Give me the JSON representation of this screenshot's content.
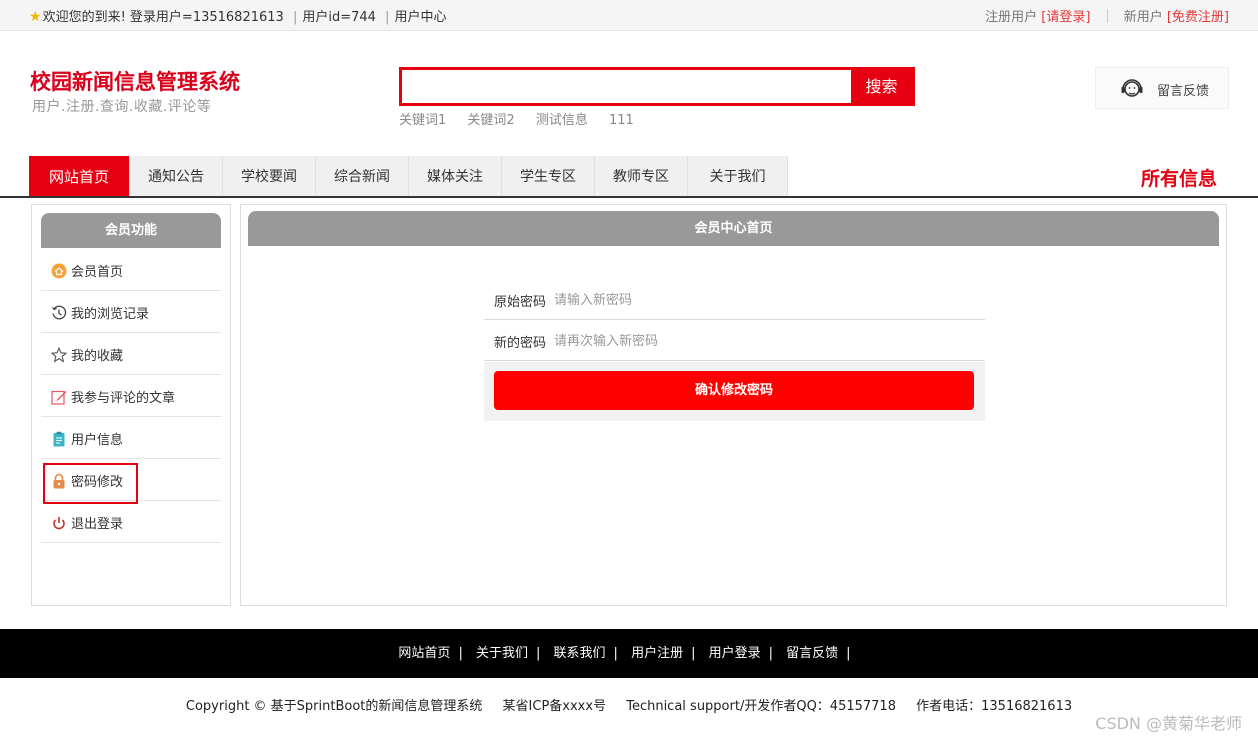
{
  "topbar": {
    "welcome": "欢迎您的到来!",
    "login_user": "登录用户=13516821613",
    "user_id": "用户id=744",
    "user_center": "用户中心",
    "register_label": "注册用户",
    "login_link": "[请登录]",
    "new_user_label": "新用户",
    "free_register_link": "[免费注册]",
    "sep": "|"
  },
  "header": {
    "title": "校园新闻信息管理系统",
    "subtitle": "用户.注册.查询.收藏.评论等",
    "search_placeholder": "",
    "search_button": "搜索",
    "keywords": [
      "关键词1",
      "关键词2",
      "测试信息",
      "111"
    ],
    "feedback_label": "留言反馈"
  },
  "nav": {
    "items": [
      {
        "label": "网站首页",
        "active": true
      },
      {
        "label": "通知公告"
      },
      {
        "label": "学校要闻"
      },
      {
        "label": "综合新闻"
      },
      {
        "label": "媒体关注"
      },
      {
        "label": "学生专区"
      },
      {
        "label": "教师专区"
      },
      {
        "label": "关于我们"
      }
    ],
    "all_info": "所有信息"
  },
  "sidebar": {
    "title": "会员功能",
    "items": [
      {
        "label": "会员首页",
        "icon": "home-icon"
      },
      {
        "label": "我的浏览记录",
        "icon": "history-icon"
      },
      {
        "label": "我的收藏",
        "icon": "star-icon"
      },
      {
        "label": "我参与评论的文章",
        "icon": "edit-icon"
      },
      {
        "label": "用户信息",
        "icon": "clipboard-icon"
      },
      {
        "label": "密码修改",
        "icon": "lock-icon",
        "highlighted": true
      },
      {
        "label": "退出登录",
        "icon": "power-icon"
      }
    ]
  },
  "main": {
    "title": "会员中心首页",
    "form": {
      "old_password_label": "原始密码",
      "old_password_placeholder": "请输入新密码",
      "new_password_label": "新的密码",
      "new_password_placeholder": "请再次输入新密码",
      "submit_button": "确认修改密码"
    }
  },
  "footer": {
    "links": [
      "网站首页",
      "关于我们",
      "联系我们",
      "用户注册",
      "用户登录",
      "留言反馈"
    ],
    "sep": "|",
    "copyright": "Copyright © 基于SprintBoot的新闻信息管理系统",
    "icp": "某省ICP备xxxx号",
    "support": "Technical support/开发作者QQ：45157718",
    "phone": "作者电话：13516821613"
  },
  "watermark": "CSDN @黄菊华老师",
  "colors": {
    "accent": "#e60012",
    "header_gray": "#999999",
    "footer_bg": "#000000"
  }
}
